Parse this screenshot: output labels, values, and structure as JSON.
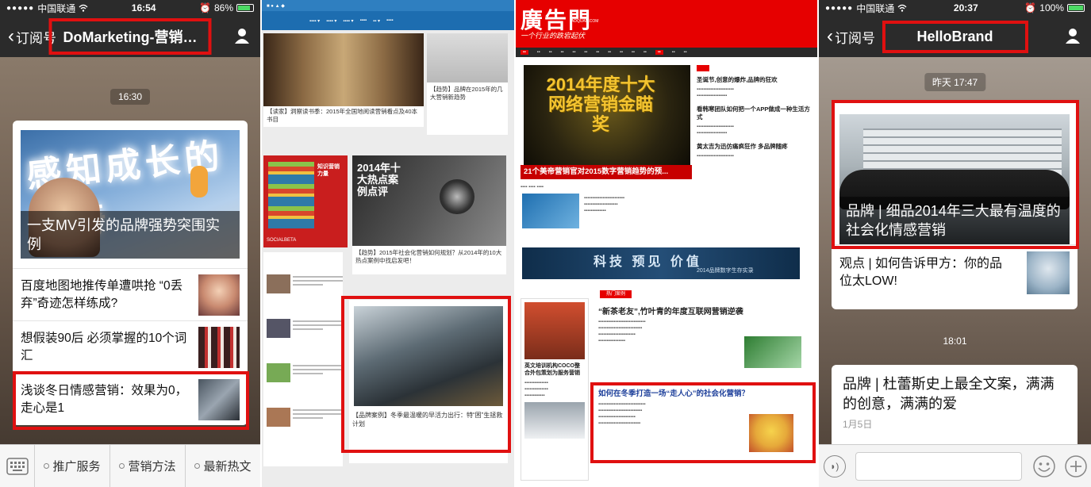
{
  "colors": {
    "highlight": "#e01010",
    "wechat_bar": "#2b2b2b",
    "adquan_red": "#e60000"
  },
  "panel1": {
    "status": {
      "carrier": "中国联通",
      "time": "16:54",
      "battery": "86%",
      "battery_level": 0.86
    },
    "back_label": "订阅号",
    "title": "DoMarketing-营销…",
    "timestamp": "16:30",
    "hero_caption": "一支MV引发的品牌强势突围实例",
    "hero_art_text": "感知成长的神奇",
    "items": [
      {
        "title": "百度地图地推传单遭哄抢 “0丢弃”奇迹怎样练成?"
      },
      {
        "title": "想假装90后 必须掌握的10个词汇"
      },
      {
        "title": "浅谈冬日情感营销：效果为0，走心是1"
      }
    ],
    "menu": [
      "推广服务",
      "营销方法",
      "最新热文"
    ]
  },
  "panel2": {
    "tile_a_title": "【读家】洞察读书季：2015年全国地阅读营销看点及40本书目",
    "tile_b_title": "【趋势】品牌在2015年的几大营销新趋势",
    "tile_c_art": "2014年十大热点案例点评",
    "tile_c_title": "【趋势】2015年社会化营销如何规划？从2014年的10大热点案例中找启发吧！",
    "tile_d_title": "【品牌案例】冬季最温暖的早活力出行：特“困”生拯救计划",
    "book_art": "知识营销力量",
    "book_tag": "SOCIALBETA"
  },
  "panel3": {
    "logo": "廣告門",
    "domain": "ADQUAN.COM",
    "slogan": "一个行业的跌宕起伏",
    "hero_text": "2014年度十大网络营销金瞄奖",
    "hero_headline": "21个美帝营销官对2015数字营销趋势的预...",
    "side_headlines": [
      "圣诞节,创意的爆炸,品牌的狂欢",
      "看韩寒团队如何把一个APP做成一种生活方式",
      "黄太吉为迅仿痛疯狂作 多品牌随疼"
    ],
    "banner": "科技 预见 价值",
    "banner_sub": "2014品牌数字生存实录",
    "tag_label": "热门案例",
    "mid_headline": "“新茶老友”,竹叶青的年度互联网营销逆袭",
    "left_caption": "英文培训机构COCO整合外包策划为服务营销",
    "bottom_headline": "如何在冬季打造一场“走人心”的社会化营销？"
  },
  "panel4": {
    "status": {
      "carrier": "中国联通",
      "time": "20:37",
      "battery": "100%",
      "battery_level": 1.0
    },
    "back_label": "订阅号",
    "title": "HelloBrand",
    "timestamp1": "昨天 17:47",
    "hero_caption": "品牌 | 细品2014年三大最有温度的社会化情感营销",
    "item1": "观点 | 如何告诉甲方：你的品位太LOW!",
    "timestamp2": "18:01",
    "card2_title": "品牌 | 杜蕾斯史上最全文案，满满的创意，满满的爱",
    "card2_date": "1月5日"
  }
}
